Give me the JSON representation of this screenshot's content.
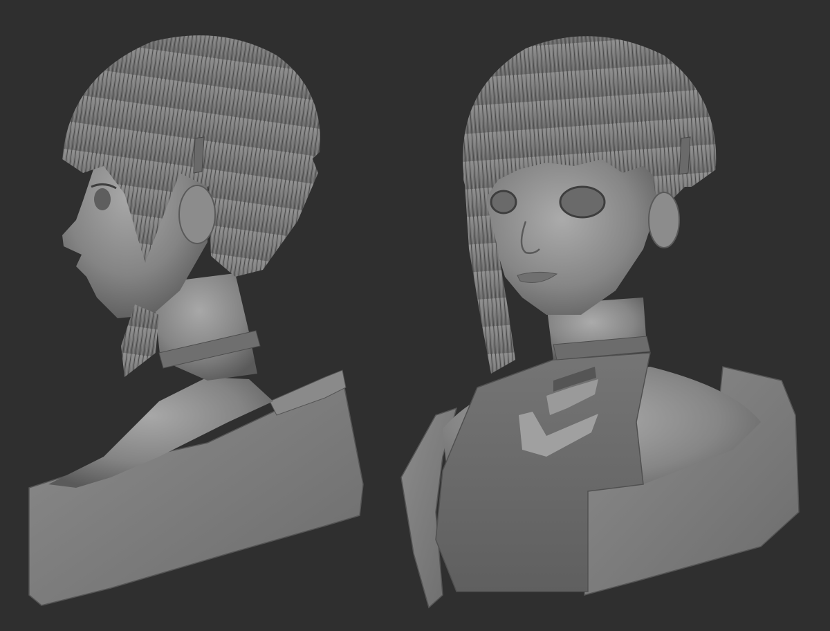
{
  "scene": {
    "background_color": "#2f2f2f",
    "clay_color": "#7a7a7a",
    "clay_highlight": "#a4a4a4",
    "clay_shadow": "#4a4a4a"
  },
  "views": [
    {
      "name": "side-view",
      "subject": "bust-profile"
    },
    {
      "name": "three-quarter-view",
      "subject": "bust-three-quarter"
    }
  ]
}
